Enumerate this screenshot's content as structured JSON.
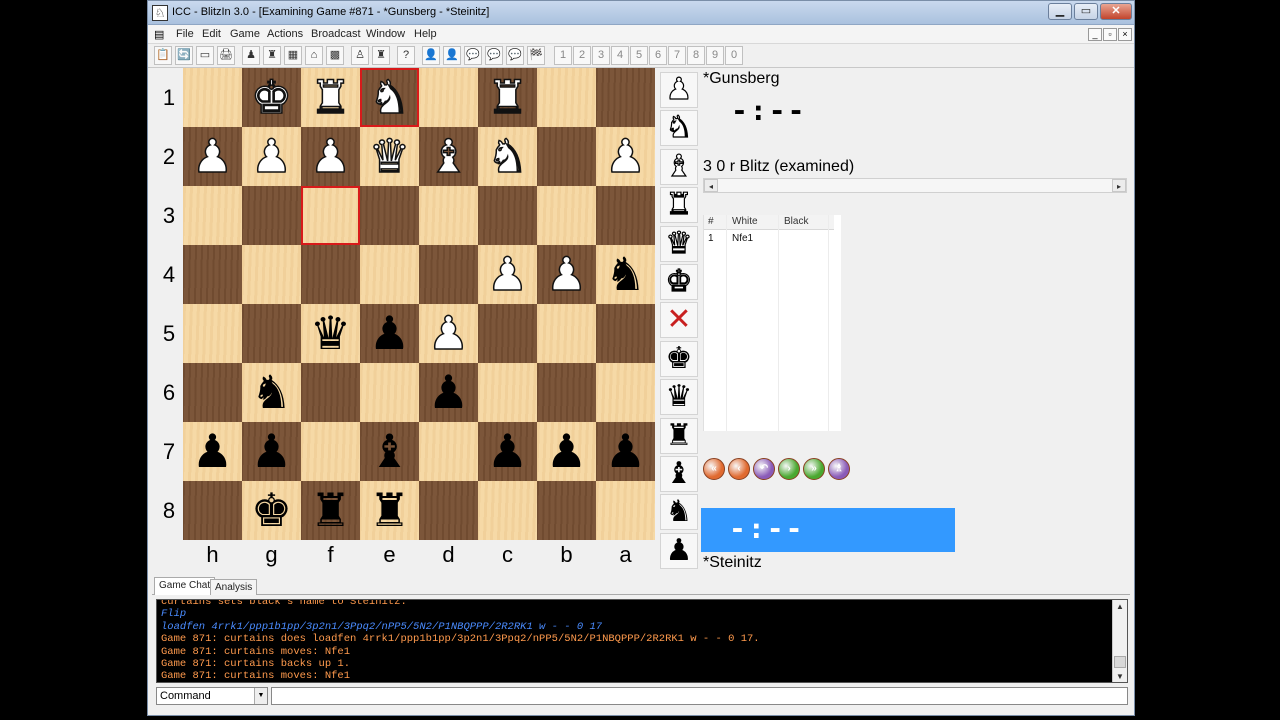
{
  "window": {
    "title": "ICC - BlitzIn 3.0 - [Examining Game #871 - *Gunsberg - *Steinitz]",
    "app_icon": "♘",
    "min_label": "▁",
    "restore_label": "▭",
    "close_label": "✕"
  },
  "menu": [
    "File",
    "Edit",
    "Game",
    "Actions",
    "Broadcast",
    "Window",
    "Help"
  ],
  "mdi_controls": [
    "_",
    "▫",
    "×"
  ],
  "toolbar": {
    "icons": [
      "📋",
      "🔄",
      "▭",
      "🖨",
      "♟",
      "♜",
      "▦",
      "⌂",
      "▩",
      "♙",
      "♜",
      "?",
      "👤",
      "👤",
      "💬",
      "💬",
      "💬",
      "🏁"
    ],
    "numbers": [
      "1",
      "2",
      "3",
      "4",
      "5",
      "6",
      "7",
      "8",
      "9",
      "0"
    ]
  },
  "board": {
    "ranks": [
      "1",
      "2",
      "3",
      "4",
      "5",
      "6",
      "7",
      "8"
    ],
    "files": [
      "h",
      "g",
      "f",
      "e",
      "d",
      "c",
      "b",
      "a"
    ],
    "highlight": [
      [
        0,
        3
      ],
      [
        2,
        2
      ]
    ],
    "pieces": [
      [
        null,
        "wK",
        "wR",
        "wN",
        null,
        "wR",
        null,
        null
      ],
      [
        "wP",
        "wP",
        "wP",
        "wQ",
        "wB",
        "wN",
        null,
        "wP"
      ],
      [
        null,
        null,
        null,
        null,
        null,
        null,
        null,
        null
      ],
      [
        null,
        null,
        null,
        null,
        null,
        "wP",
        "wP",
        "bN"
      ],
      [
        null,
        null,
        "bQ",
        "bP",
        "wP",
        null,
        null,
        null
      ],
      [
        null,
        "bN",
        null,
        null,
        "bP",
        null,
        null,
        null
      ],
      [
        "bP",
        "bP",
        null,
        "bB",
        null,
        "bP",
        "bP",
        "bP"
      ],
      [
        null,
        "bK",
        "bR",
        "bR",
        null,
        null,
        null,
        null
      ]
    ]
  },
  "glyphs": {
    "K": "♚",
    "Q": "♛",
    "R": "♜",
    "B": "♝",
    "N": "♞",
    "P": "♟"
  },
  "palette": [
    {
      "name": "white-pawn",
      "piece": "P",
      "color": "w"
    },
    {
      "name": "white-knight",
      "piece": "N",
      "color": "w"
    },
    {
      "name": "white-bishop",
      "piece": "B",
      "color": "w"
    },
    {
      "name": "white-rook",
      "piece": "R",
      "color": "w"
    },
    {
      "name": "white-queen",
      "piece": "Q",
      "color": "w"
    },
    {
      "name": "white-king",
      "piece": "K",
      "color": "w"
    },
    {
      "name": "clear-square",
      "piece": "X",
      "color": "x"
    },
    {
      "name": "black-king",
      "piece": "K",
      "color": "b"
    },
    {
      "name": "black-queen",
      "piece": "Q",
      "color": "b"
    },
    {
      "name": "black-rook",
      "piece": "R",
      "color": "b"
    },
    {
      "name": "black-bishop",
      "piece": "B",
      "color": "b"
    },
    {
      "name": "black-knight",
      "piece": "N",
      "color": "b"
    },
    {
      "name": "black-pawn",
      "piece": "P",
      "color": "b"
    }
  ],
  "players": {
    "white": {
      "name": "*Gunsberg",
      "clock": "-:--"
    },
    "black": {
      "name": "*Steinitz",
      "clock": "-:--"
    }
  },
  "game_info": "3 0 r Blitz (examined)",
  "movelist": {
    "headers": [
      "#",
      "White",
      "Black"
    ],
    "rows": [
      {
        "num": "1",
        "white": "Nfe1",
        "black": ""
      }
    ]
  },
  "nav_buttons": [
    {
      "name": "first-move",
      "label": "«",
      "color": "#e06a30"
    },
    {
      "name": "prev-move",
      "label": "‹",
      "color": "#e06a30"
    },
    {
      "name": "revert",
      "label": "↶",
      "color": "#8a5bb8"
    },
    {
      "name": "next-move",
      "label": "›",
      "color": "#4aa830"
    },
    {
      "name": "last-move",
      "label": "»",
      "color": "#4aa830"
    },
    {
      "name": "analysis",
      "label": "♗",
      "color": "#8a5bb8"
    }
  ],
  "chat": {
    "tabs": [
      "Game Chat",
      "Analysis"
    ],
    "lines": [
      {
        "text": "curtains sets black's name to Steinitz.",
        "style": "orange"
      },
      {
        "text": "Flip",
        "style": "blue"
      },
      {
        "text": "loadfen 4rrk1/ppp1b1pp/3p2n1/3Ppq2/nPP5/5N2/P1NBQPPP/2R2RK1 w - - 0 17",
        "style": "blue"
      },
      {
        "text": "Game 871: curtains does loadfen 4rrk1/ppp1b1pp/3p2n1/3Ppq2/nPP5/5N2/P1NBQPPP/2R2RK1 w - - 0 17.",
        "style": "orange"
      },
      {
        "text": "Game 871: curtains moves: Nfe1",
        "style": "orange"
      },
      {
        "text": "Game 871: curtains backs up 1.",
        "style": "orange"
      },
      {
        "text": "Game 871: curtains moves: Nfe1",
        "style": "orange"
      }
    ]
  },
  "command": {
    "selected": "Command",
    "input_value": ""
  },
  "colors": {
    "light_square": "#f5d7a1",
    "dark_square": "#7b5539",
    "highlight": "#d81a1a",
    "black_clock_bg": "#3399ff"
  }
}
